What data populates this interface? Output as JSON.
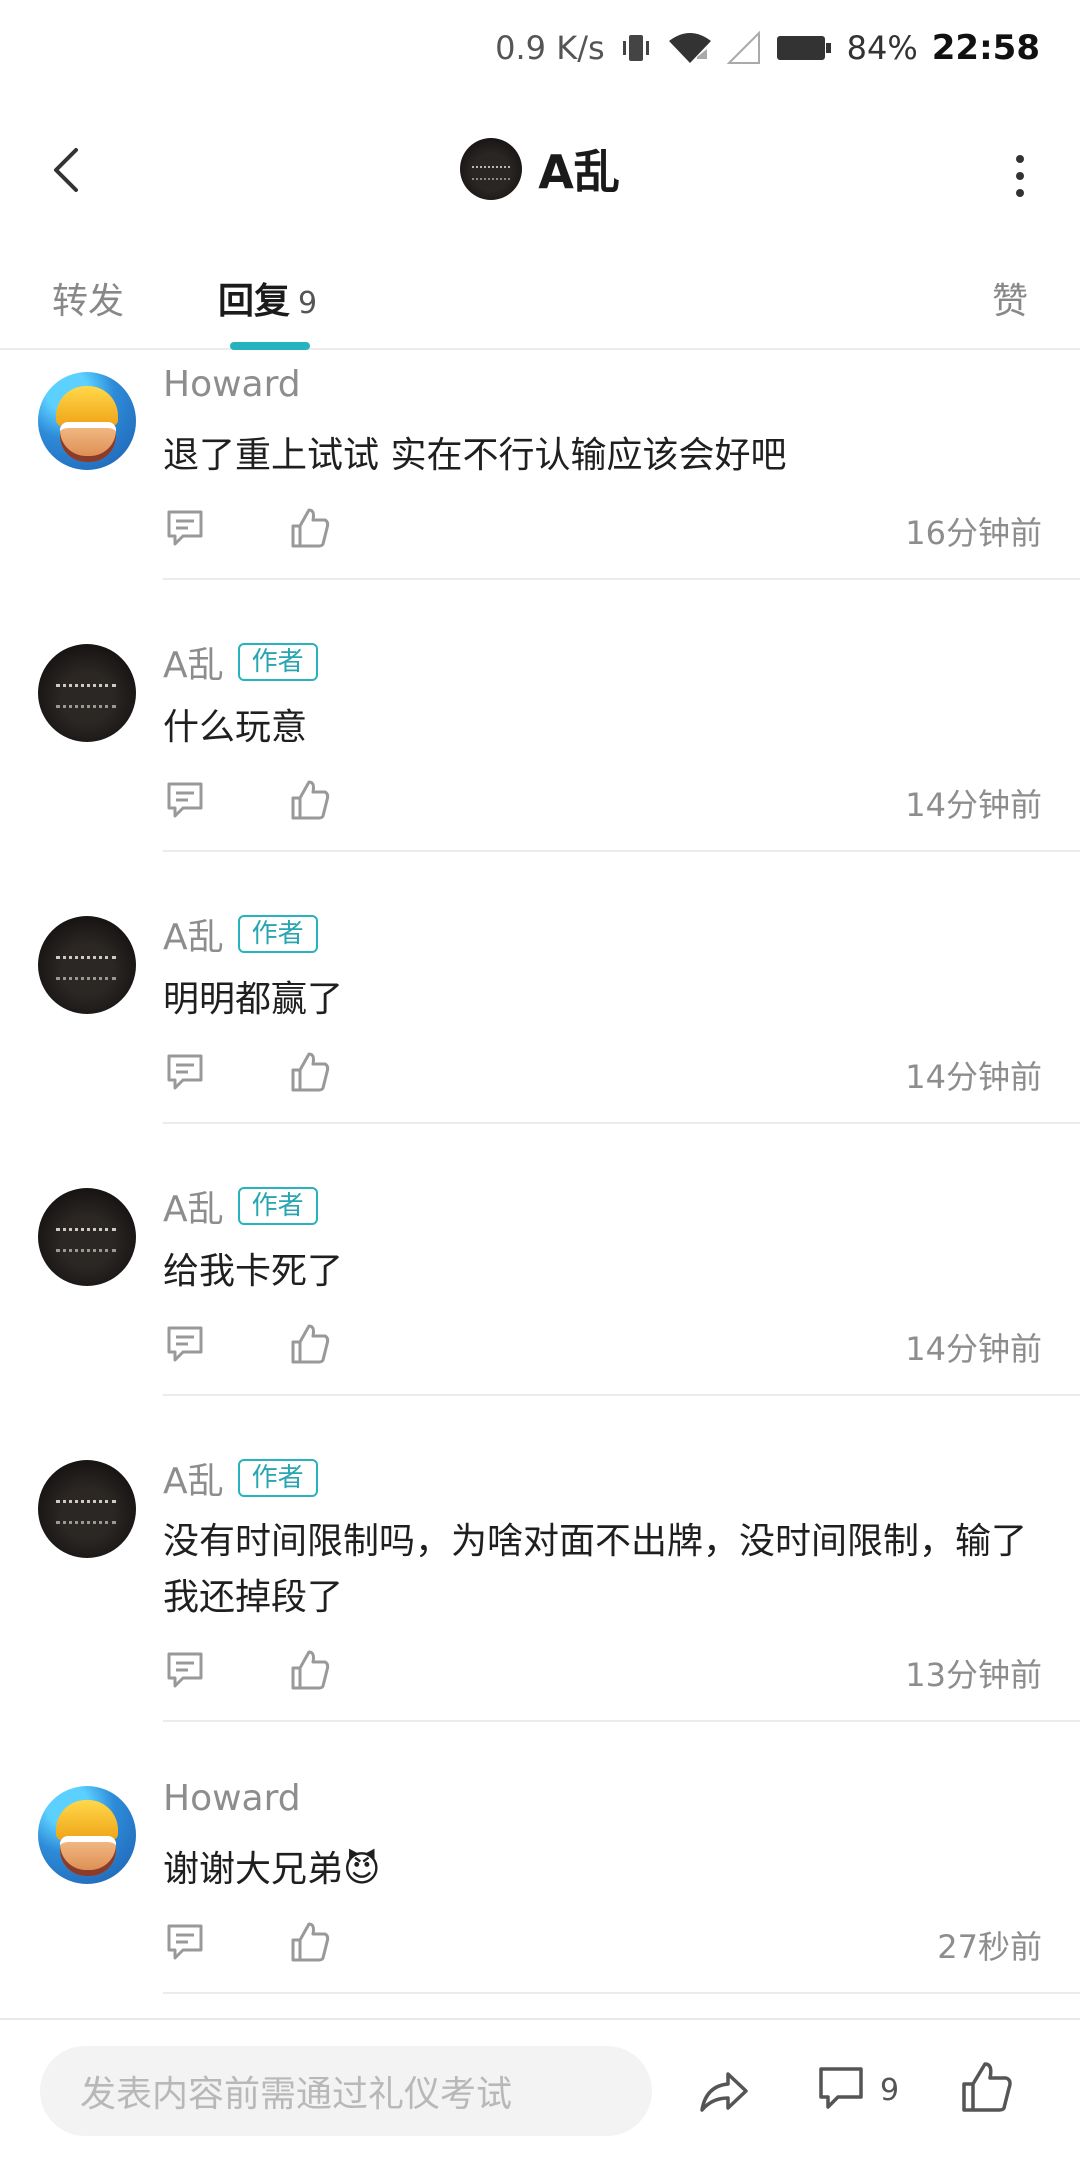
{
  "status_bar": {
    "speed": "0.9 K/s",
    "battery": "84%",
    "time": "22:58"
  },
  "header": {
    "title": "A乱",
    "back_icon": "chevron-left-icon",
    "more_icon": "more-vertical-icon"
  },
  "tabs": {
    "forward": "转发",
    "reply": "回复",
    "reply_count": "9",
    "like": "赞",
    "accent_color": "#27b3bd"
  },
  "comments": [
    {
      "name": "Howard",
      "author": false,
      "text": "退了重上试试 实在不行认输应该会好吧",
      "time": "16分钟前"
    },
    {
      "name": "A乱",
      "author": true,
      "badge": "作者",
      "text": "什么玩意",
      "time": "14分钟前"
    },
    {
      "name": "A乱",
      "author": true,
      "badge": "作者",
      "text": "明明都赢了",
      "time": "14分钟前"
    },
    {
      "name": "A乱",
      "author": true,
      "badge": "作者",
      "text": "给我卡死了",
      "time": "14分钟前"
    },
    {
      "name": "A乱",
      "author": true,
      "badge": "作者",
      "text": "没有时间限制吗，为啥对面不出牌，没时间限制，输了我还掉段了",
      "time": "13分钟前"
    },
    {
      "name": "Howard",
      "author": false,
      "text": "谢谢大兄弟😈",
      "time": "27秒前"
    }
  ],
  "bottom_bar": {
    "placeholder": "发表内容前需通过礼仪考试",
    "comment_count": "9"
  }
}
